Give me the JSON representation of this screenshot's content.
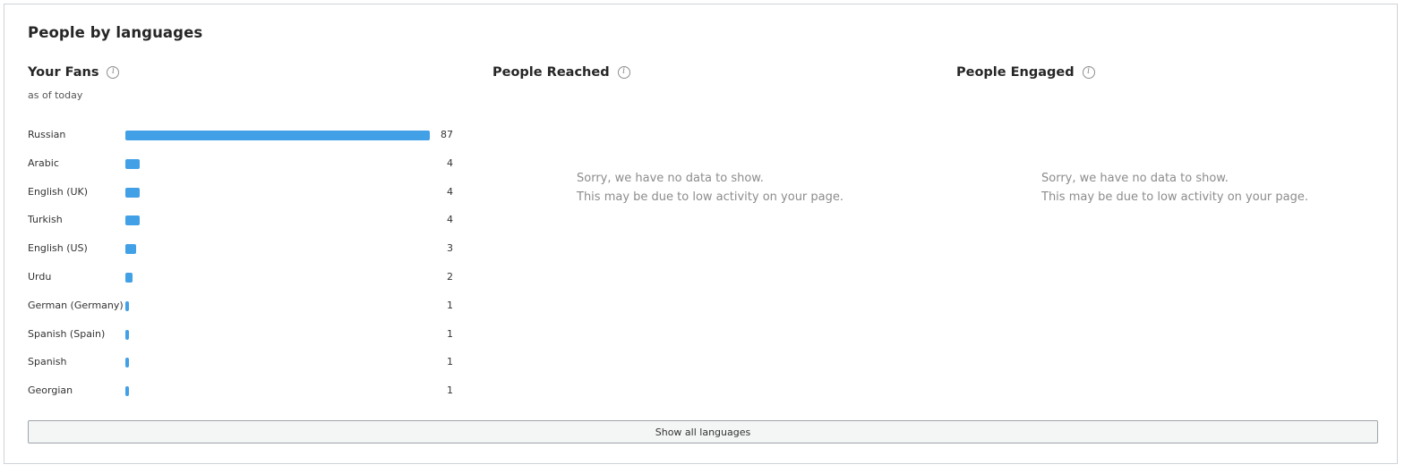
{
  "panel": {
    "title": "People by languages",
    "show_all_label": "Show all languages"
  },
  "fans": {
    "heading": "Your Fans",
    "subtitle": "as of today",
    "info_icon": "info-icon"
  },
  "reached": {
    "heading": "People Reached",
    "info_icon": "info-icon",
    "empty_line1": "Sorry, we have no data to show.",
    "empty_line2": "This may be due to low activity on your page."
  },
  "engaged": {
    "heading": "People Engaged",
    "info_icon": "info-icon",
    "empty_line1": "Sorry, we have no data to show.",
    "empty_line2": "This may be due to low activity on your page."
  },
  "colors": {
    "bar": "#42a0e6"
  },
  "chart_data": {
    "type": "bar",
    "orientation": "horizontal",
    "categories": [
      "Russian",
      "Arabic",
      "English (UK)",
      "Turkish",
      "English (US)",
      "Urdu",
      "German (Germany)",
      "Spanish (Spain)",
      "Spanish",
      "Georgian"
    ],
    "values": [
      87,
      4,
      4,
      4,
      3,
      2,
      1,
      1,
      1,
      1
    ],
    "xlim": [
      0,
      87
    ],
    "grid": false,
    "legend": "none"
  }
}
